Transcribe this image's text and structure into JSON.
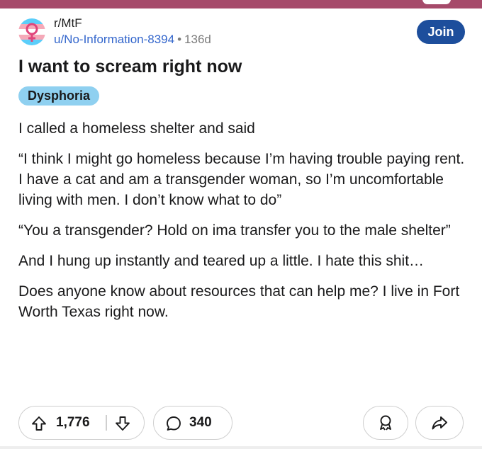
{
  "post": {
    "subreddit": "r/MtF",
    "username": "u/No-Information-8394",
    "separator": "•",
    "age": "136d",
    "join_label": "Join",
    "title": "I want to scream right now",
    "flair": "Dysphoria",
    "paragraphs": [
      "I called a homeless shelter and said",
      "“I think I might go homeless because I’m having trouble paying rent. I have a cat and am a transgender woman, so I’m uncomfortable living with men. I don’t know what to do”",
      "“You a transgender? Hold on ima transfer you to the male shelter”",
      "And I hung up instantly and teared up a little. I hate this shit…",
      "Does anyone know about resources that can help me? I live in Fort Worth Texas right now."
    ]
  },
  "actions": {
    "upvotes": "1,776",
    "comments": "340",
    "upvote_icon": "arrow-up-icon",
    "downvote_icon": "arrow-down-icon",
    "comment_icon": "comment-bubble-icon",
    "award_icon": "award-icon",
    "share_icon": "share-arrow-icon"
  },
  "colors": {
    "top_bar": "#a64a6a",
    "join_button": "#1d4e9c",
    "flair_bg": "#8fd0f0",
    "username": "#3366cc"
  }
}
